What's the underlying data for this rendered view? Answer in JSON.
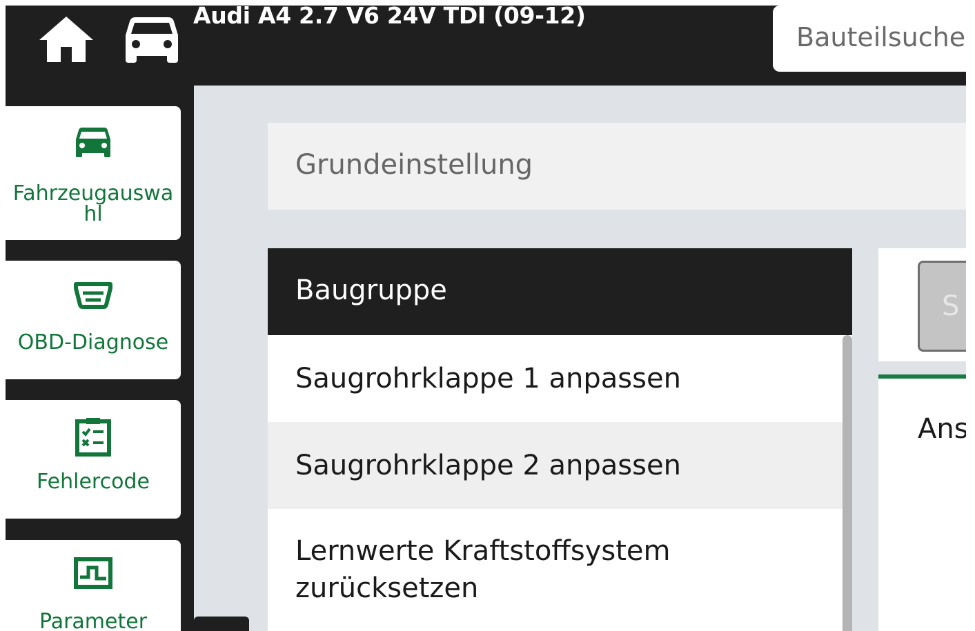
{
  "header": {
    "vehicle_title": "Audi A4 2.7 V6 24V TDI (09-12)",
    "search_placeholder": "Bauteilsuche",
    "home_icon": "home-icon",
    "car_icon": "car-icon"
  },
  "sidebar": {
    "items": [
      {
        "label": "Fahrzeugauswahl",
        "icon": "car-icon"
      },
      {
        "label": "OBD-Diagnose",
        "icon": "obd-connector-icon"
      },
      {
        "label": "Fehlercode",
        "icon": "checklist-icon"
      },
      {
        "label": "Parameter",
        "icon": "signal-wave-icon"
      }
    ]
  },
  "main": {
    "section_title": "Grundeinstellung",
    "group_header": "Baugruppe",
    "rows": [
      "Saugrohrklappe 1 anpassen",
      "Saugrohrklappe 2 anpassen",
      "Lernwerte Kraftstoffsystem zurücksetzen"
    ],
    "right_button_label": "S",
    "right_panel_text": "Ans"
  },
  "colors": {
    "header_bg": "#1f1f1f",
    "accent_green": "#12753a",
    "page_bg": "#dfe3e7"
  }
}
